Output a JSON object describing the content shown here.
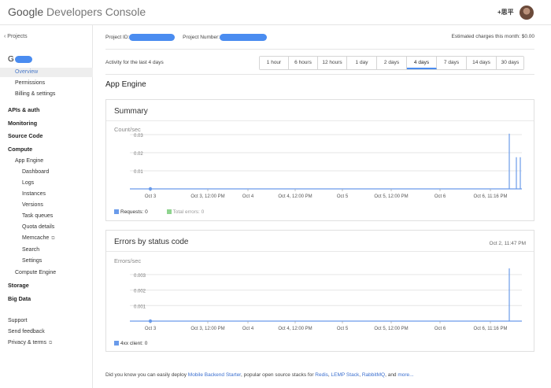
{
  "header": {
    "brand_google": "Google",
    "brand_rest": " Developers Console",
    "user_name": "+思平"
  },
  "sidebar": {
    "back_label": "Projects",
    "project_initial": "G",
    "items": [
      {
        "label": "Overview",
        "level": 2,
        "bold": false,
        "active": true
      },
      {
        "label": "Permissions",
        "level": 2,
        "bold": false
      },
      {
        "label": "Billing & settings",
        "level": 2,
        "bold": false
      },
      {
        "label": "APIs & auth",
        "level": 1,
        "bold": true
      },
      {
        "label": "Monitoring",
        "level": 1,
        "bold": true
      },
      {
        "label": "Source Code",
        "level": 1,
        "bold": true
      },
      {
        "label": "Compute",
        "level": 1,
        "bold": true
      },
      {
        "label": "App Engine",
        "level": 2,
        "bold": false
      },
      {
        "label": "Dashboard",
        "level": 3,
        "bold": false
      },
      {
        "label": "Logs",
        "level": 3,
        "bold": false
      },
      {
        "label": "Instances",
        "level": 3,
        "bold": false
      },
      {
        "label": "Versions",
        "level": 3,
        "bold": false
      },
      {
        "label": "Task queues",
        "level": 3,
        "bold": false
      },
      {
        "label": "Quota details",
        "level": 3,
        "bold": false
      },
      {
        "label": "Memcache",
        "level": 3,
        "bold": false,
        "external": true
      },
      {
        "label": "Search",
        "level": 3,
        "bold": false
      },
      {
        "label": "Settings",
        "level": 3,
        "bold": false
      },
      {
        "label": "Compute Engine",
        "level": 2,
        "bold": false
      },
      {
        "label": "Storage",
        "level": 1,
        "bold": true
      },
      {
        "label": "Big Data",
        "level": 1,
        "bold": true
      },
      {
        "label": "Support",
        "level": 1,
        "bold": false
      },
      {
        "label": "Send feedback",
        "level": 1,
        "bold": false
      },
      {
        "label": "Privacy & terms",
        "level": 1,
        "bold": false,
        "external": true
      }
    ]
  },
  "main": {
    "project_id_label": "Project ID:",
    "project_number_label": "Project Number:",
    "estimated_charges": "Estimated charges this month: $0.00",
    "activity_label": "Activity for the last 4 days",
    "ranges": [
      "1 hour",
      "6 hours",
      "12 hours",
      "1 day",
      "2 days",
      "4 days",
      "7 days",
      "14 days",
      "30 days"
    ],
    "selected_range": "4 days",
    "section_title": "App Engine",
    "tip": {
      "prefix": "Did you know you can easily deploy ",
      "link1": "Mobile Backend Starter",
      "middle": ", popular open source stacks for ",
      "link2": "Redis",
      "sep1": ", ",
      "link3": "LEMP Stack",
      "sep2": ", ",
      "link4": "RabbitMQ",
      "sep3": ", and ",
      "link5": "more..."
    }
  },
  "colors": {
    "accent": "#4a8cf0",
    "link": "#3b6fcf",
    "requests": "#6a9bea",
    "errors": "#8fd48f"
  },
  "chart_data": [
    {
      "type": "line",
      "title": "Summary",
      "ylabel": "Count/sec",
      "ylim": [
        0,
        0.03
      ],
      "yticks": [
        "0.03",
        "0.02",
        "0.01"
      ],
      "xticks": [
        "Oct 3",
        "Oct 3, 12:00 PM",
        "Oct 4",
        "Oct 4, 12:00 PM",
        "Oct 5",
        "Oct 5, 12:00 PM",
        "Oct 6",
        "Oct 6, 11:16 PM"
      ],
      "x": [
        "Oct 3",
        "Oct 6, ~12:30 PM",
        "Oct 6, ~2:00 PM",
        "Oct 6, ~3:00 PM"
      ],
      "series": [
        {
          "name": "Requests: 0",
          "color": "#6a9bea",
          "values": [
            0,
            0.0305,
            0.0175,
            0.0175
          ]
        },
        {
          "name": "Total errors: 0",
          "color": "#8fd48f",
          "values": [
            0,
            0,
            0,
            0
          ]
        }
      ],
      "legend": "bottom-left",
      "grid": true
    },
    {
      "type": "line",
      "title": "Errors by status code",
      "timestamp": "Oct 2, 11:47 PM",
      "ylabel": "Errors/sec",
      "ylim": [
        0,
        0.0035
      ],
      "yticks": [
        "0.003",
        "0.002",
        "0.001"
      ],
      "xticks": [
        "Oct 3",
        "Oct 3, 12:00 PM",
        "Oct 4",
        "Oct 4, 12:00 PM",
        "Oct 5",
        "Oct 5, 12:00 PM",
        "Oct 6",
        "Oct 6, 11:16 PM"
      ],
      "x": [
        "Oct 3",
        "Oct 6, ~12:30 PM"
      ],
      "series": [
        {
          "name": "4xx client: 0",
          "color": "#6a9bea",
          "values": [
            0,
            0.0034
          ]
        }
      ],
      "legend": "bottom-left",
      "grid": true
    }
  ]
}
